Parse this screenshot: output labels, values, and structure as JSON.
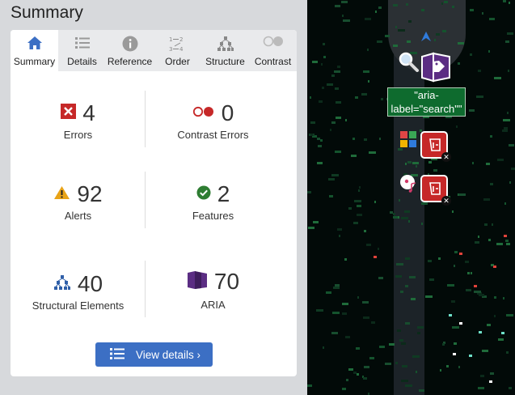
{
  "panel": {
    "title": "Summary"
  },
  "tabs": [
    {
      "label": "Summary",
      "icon": "home-icon",
      "active": true
    },
    {
      "label": "Details",
      "icon": "list-icon"
    },
    {
      "label": "Reference",
      "icon": "info-icon"
    },
    {
      "label": "Order",
      "icon": "order-icon"
    },
    {
      "label": "Structure",
      "icon": "structure-icon"
    },
    {
      "label": "Contrast",
      "icon": "contrast-icon"
    }
  ],
  "stats": {
    "errors": {
      "count": "4",
      "label": "Errors"
    },
    "contrast": {
      "count": "0",
      "label": "Contrast Errors"
    },
    "alerts": {
      "count": "92",
      "label": "Alerts"
    },
    "features": {
      "count": "2",
      "label": "Features"
    },
    "structure": {
      "count": "40",
      "label": "Structural Elements"
    },
    "aria": {
      "count": "70",
      "label": "ARIA"
    }
  },
  "view_button": {
    "label": "View details ›"
  },
  "overlay": {
    "aria_label_tag": "\"aria-label=\"search\"\""
  },
  "colors": {
    "error": "#c62828",
    "alert": "#e8a317",
    "feature": "#2e7d32",
    "structure": "#2f5fa8",
    "aria": "#5b2d83",
    "accent": "#3c6fc4"
  }
}
